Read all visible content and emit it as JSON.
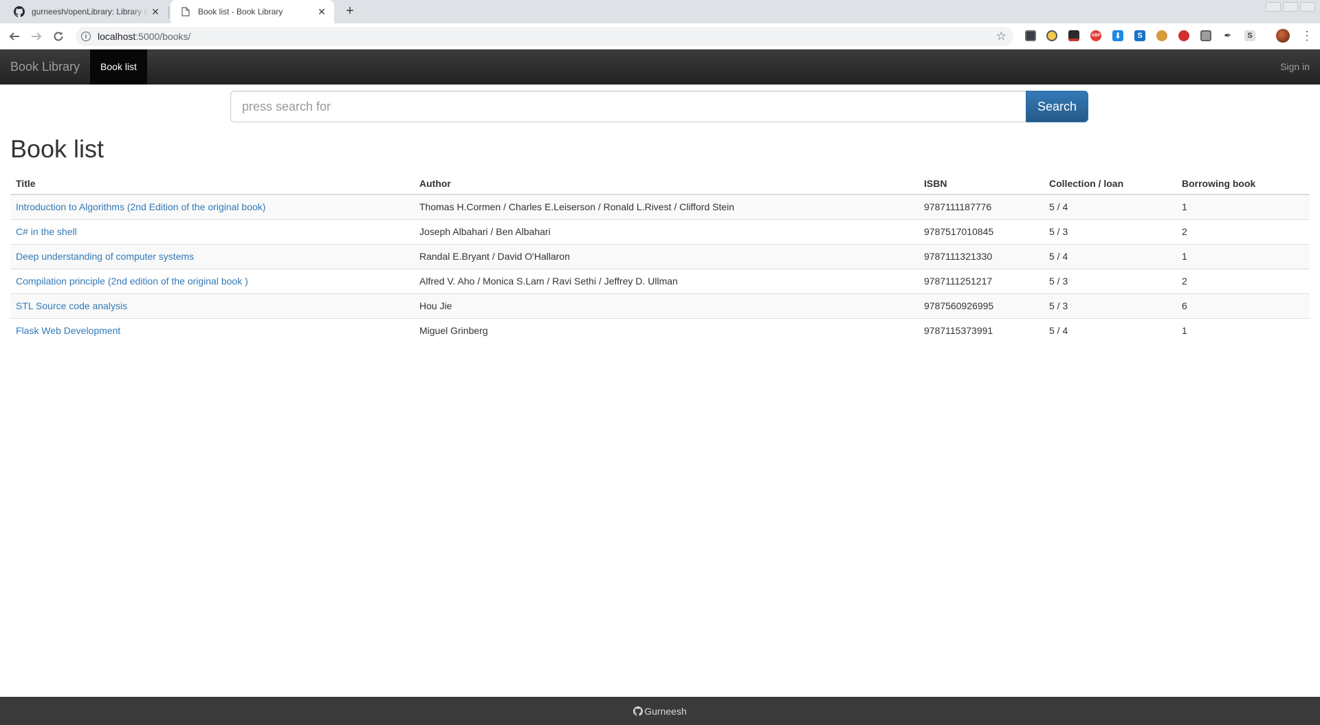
{
  "browser": {
    "tabs": [
      {
        "title": "gurneesh/openLibrary: Library m",
        "favicon": "github-icon",
        "active": false
      },
      {
        "title": "Book list - Book Library",
        "favicon": "page-icon",
        "active": true
      }
    ],
    "address": {
      "host": "localhost",
      "rest": ":5000/books/"
    },
    "extensions": [
      "keepass-icon",
      "bulb-icon",
      "hat-icon",
      "adblock-icon",
      "download-icon",
      "skype-icon",
      "cookie-icon",
      "stop-icon",
      "square-icon",
      "bird-icon",
      "s-icon"
    ],
    "extension_labels": {
      "adblock": "ABP",
      "skype": "S",
      "s": "S"
    }
  },
  "site": {
    "brand": "Book Library",
    "nav_active": "Book list",
    "signin": "Sign in"
  },
  "search": {
    "placeholder": "press search for",
    "button": "Search"
  },
  "page": {
    "title": "Book list"
  },
  "table": {
    "headers": [
      "Title",
      "Author",
      "ISBN",
      "Collection / loan",
      "Borrowing book"
    ],
    "rows": [
      {
        "title": "Introduction to Algorithms (2nd Edition of the original book)",
        "author": "Thomas H.Cormen / Charles E.Leiserson / Ronald L.Rivest / Clifford Stein",
        "isbn": "9787111187776",
        "collection": "5 / 4",
        "borrowing": "1"
      },
      {
        "title": "C# in the shell",
        "author": "Joseph Albahari / Ben Albahari",
        "isbn": "9787517010845",
        "collection": "5 / 3",
        "borrowing": "2"
      },
      {
        "title": "Deep understanding of computer systems",
        "author": "Randal E.Bryant / David O'Hallaron",
        "isbn": "9787111321330",
        "collection": "5 / 4",
        "borrowing": "1"
      },
      {
        "title": "Compilation principle (2nd edition of the original book )",
        "author": "Alfred V. Aho / Monica S.Lam / Ravi Sethi / Jeffrey D. Ullman",
        "isbn": "9787111251217",
        "collection": "5 / 3",
        "borrowing": "2"
      },
      {
        "title": "STL Source code analysis",
        "author": "Hou Jie",
        "isbn": "9787560926995",
        "collection": "5 / 3",
        "borrowing": "6"
      },
      {
        "title": "Flask Web Development",
        "author": "Miguel Grinberg",
        "isbn": "9787115373991",
        "collection": "5 / 4",
        "borrowing": "1"
      }
    ]
  },
  "footer": {
    "text": "Gurneesh",
    "icon": "github-icon"
  },
  "colors": {
    "link": "#337ab7",
    "navbar": "#222222",
    "search_button": "#337ab7",
    "footer": "#3a3a3a"
  }
}
